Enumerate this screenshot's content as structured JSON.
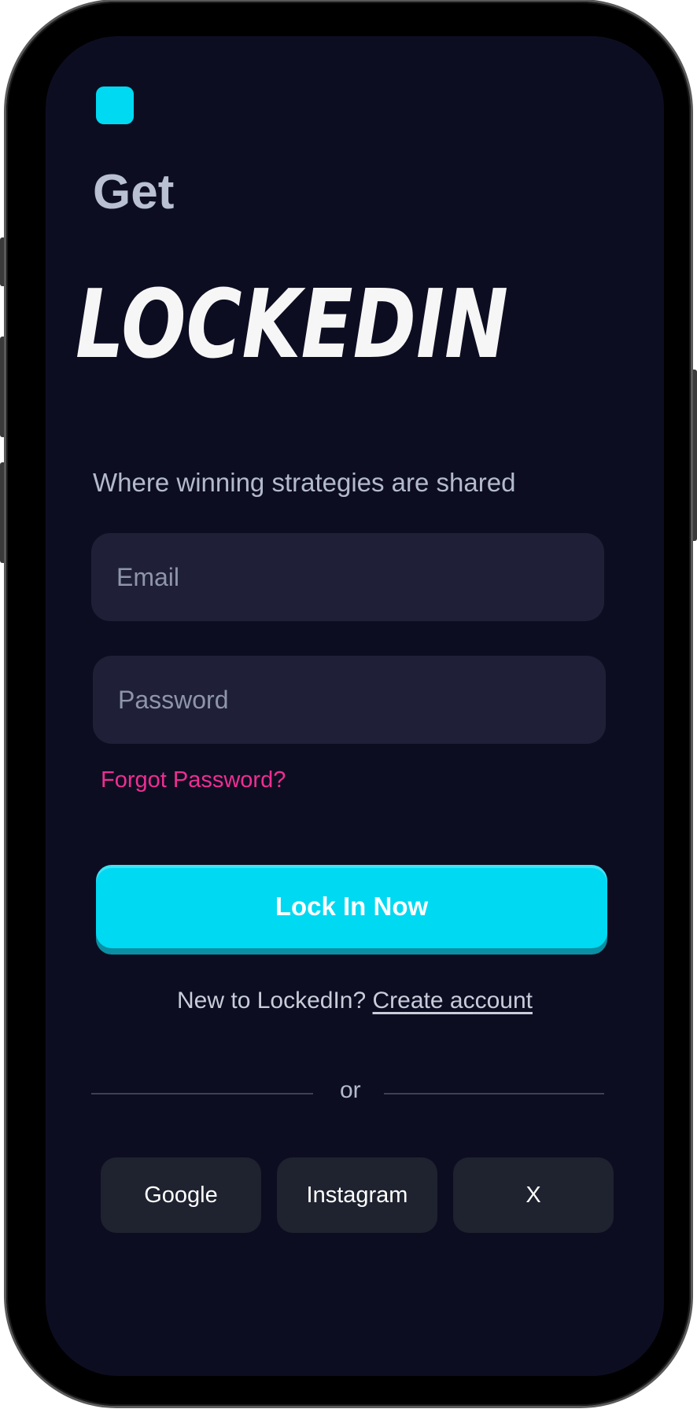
{
  "header": {
    "get_label": "Get",
    "brand_name": "LOCKEDIN",
    "tagline": "Where winning strategies are shared"
  },
  "form": {
    "email_placeholder": "Email",
    "email_value": "",
    "password_placeholder": "Password",
    "password_value": "",
    "forgot_label": "Forgot Password?",
    "submit_label": "Lock In Now"
  },
  "signup": {
    "prompt": "New to LockedIn?",
    "link_label": "Create account"
  },
  "divider": {
    "label": "or"
  },
  "social": {
    "google_label": "Google",
    "instagram_label": "Instagram",
    "x_label": "X"
  },
  "colors": {
    "background": "#0d0d22",
    "accent": "#00d9f2",
    "link": "#ee2e92",
    "field": "#1f1f37"
  }
}
